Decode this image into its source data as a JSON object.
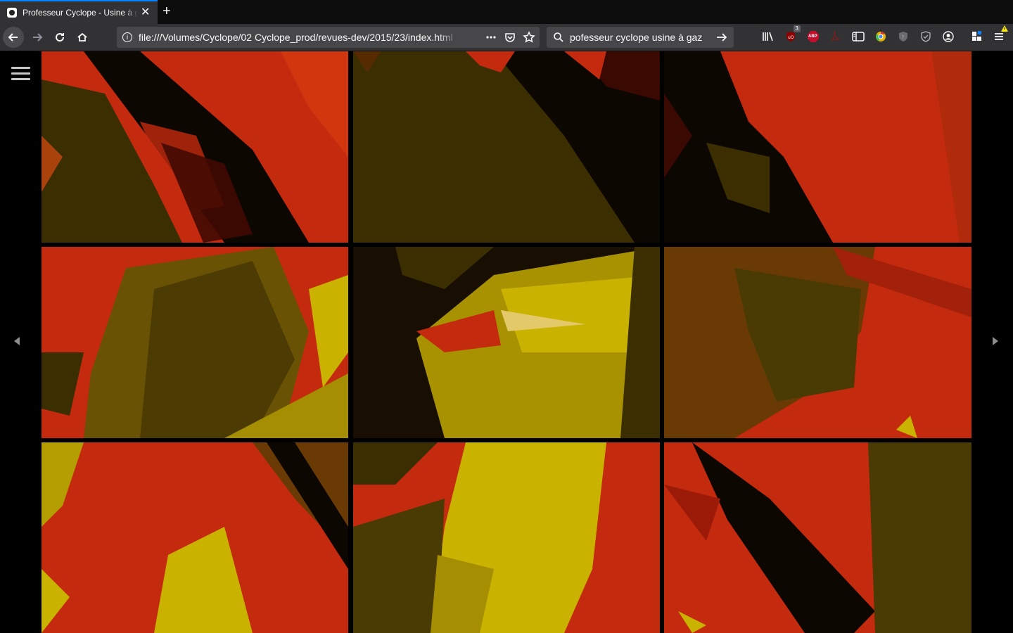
{
  "browser": {
    "tab_title": "Professeur Cyclope - Usine à gaz",
    "url": "file:///Volumes/Cyclope/02 Cyclope_prod/revues-dev/2015/23/index.html",
    "search_query": "pofesseur cyclope usine à gaz",
    "ublock_badge": "3",
    "abp_label": "ABP"
  },
  "colors": {
    "red": "#c42a0e",
    "dark_olive": "#3b2f02",
    "olive": "#6a5204",
    "yellow": "#c9b200",
    "black": "#0d0702"
  },
  "gallery": {
    "tiles": [
      {
        "name": "tile-1",
        "icon": "abstract-painting-fragment"
      },
      {
        "name": "tile-2",
        "icon": "abstract-painting-fragment"
      },
      {
        "name": "tile-3",
        "icon": "abstract-painting-fragment"
      },
      {
        "name": "tile-4",
        "icon": "abstract-painting-fragment"
      },
      {
        "name": "tile-5",
        "icon": "abstract-painting-fragment"
      },
      {
        "name": "tile-6",
        "icon": "abstract-painting-fragment"
      },
      {
        "name": "tile-7",
        "icon": "abstract-painting-fragment"
      },
      {
        "name": "tile-8",
        "icon": "abstract-painting-fragment"
      },
      {
        "name": "tile-9",
        "icon": "abstract-painting-fragment"
      }
    ]
  }
}
